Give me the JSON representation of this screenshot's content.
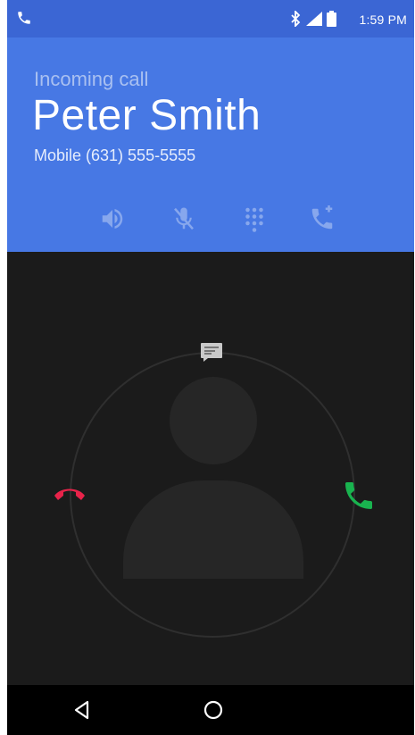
{
  "status_bar": {
    "time": "1:59 PM",
    "icons": [
      "phone-icon",
      "bluetooth-icon",
      "signal-icon",
      "battery-icon"
    ]
  },
  "call": {
    "incoming_label": "Incoming call",
    "caller_name": "Peter Smith",
    "caller_number": "Mobile (631) 555-5555"
  },
  "controls": {
    "icons": [
      "speaker-icon",
      "mute-icon",
      "dialpad-icon",
      "merge-call-icon"
    ]
  },
  "actions": {
    "icons": [
      "message-icon",
      "decline-icon",
      "answer-icon"
    ]
  },
  "navigation": {
    "icons": [
      "back-icon",
      "home-icon"
    ]
  },
  "colors": {
    "status_bar": "#3b66d4",
    "header": "#4778e4",
    "call_area": "#1b1b1b",
    "decline": "#e8234a",
    "answer": "#19b34f"
  }
}
